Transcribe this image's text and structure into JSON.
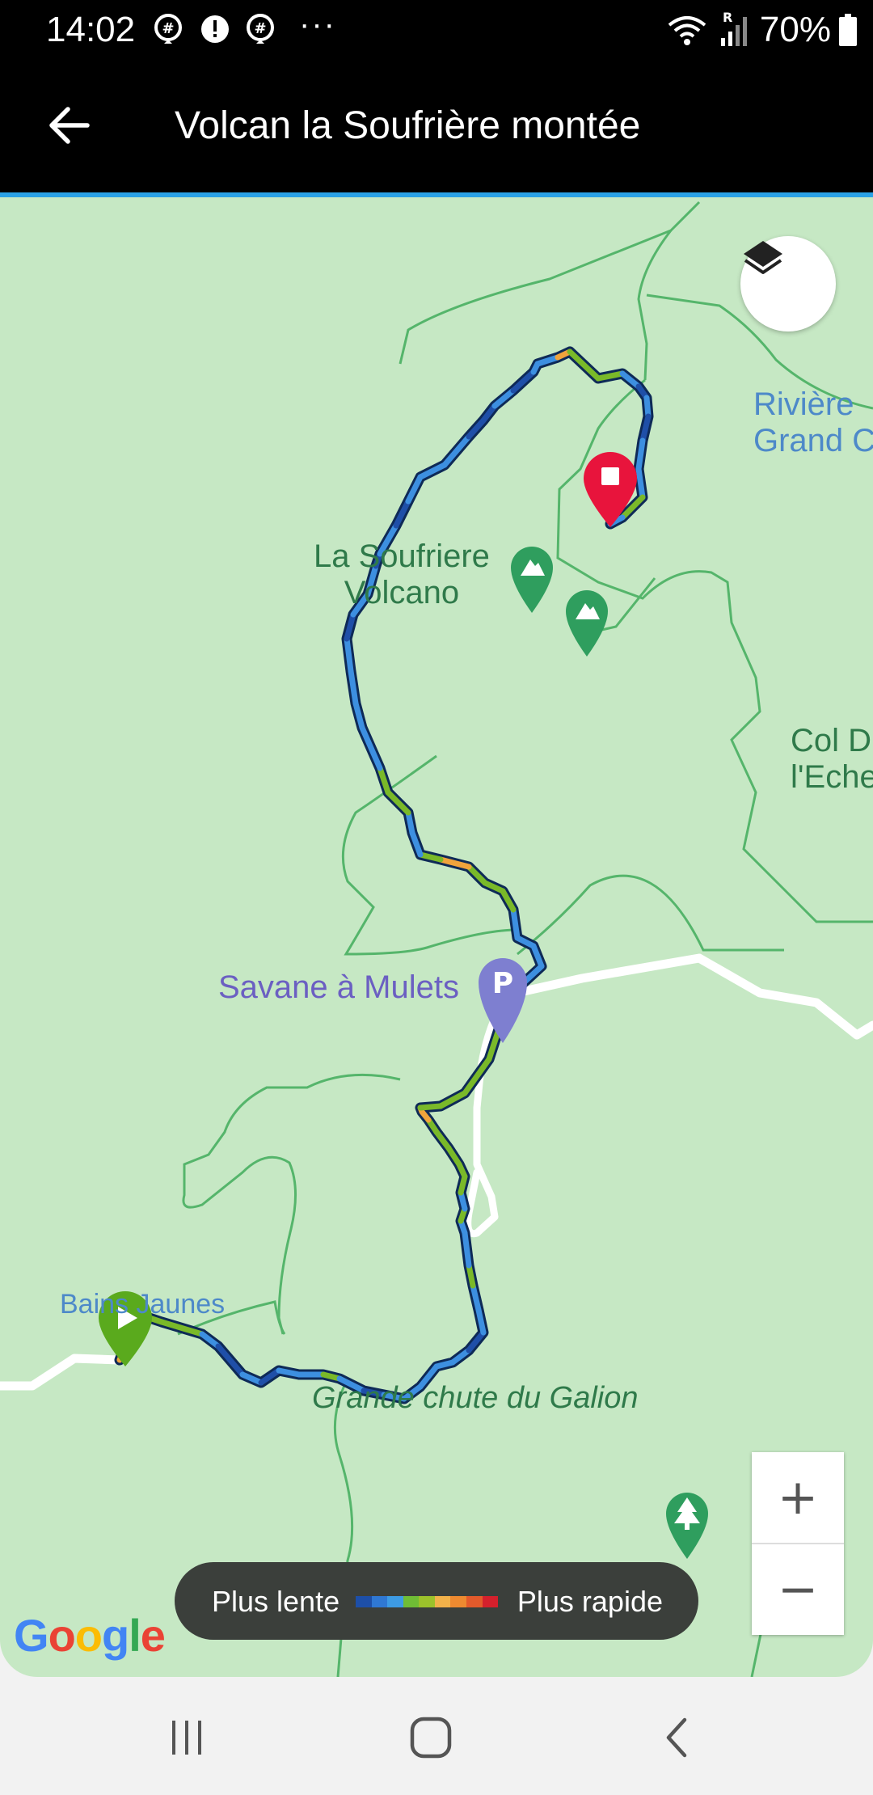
{
  "status_bar": {
    "time": "14:02",
    "dots": "···",
    "battery": "70%",
    "icons": [
      "hashtag-notification-icon",
      "alert-notification-icon",
      "hashtag-notification-icon",
      "wifi-icon",
      "roaming-signal-icon",
      "battery-icon"
    ]
  },
  "app_bar": {
    "title": "Volcan la Soufrière montée",
    "back_icon": "arrow-left-icon"
  },
  "map": {
    "labels": {
      "riviere": "Rivière\nGrand C",
      "soufriere": "La Soufriere\nVolcano",
      "col": "Col D\nl'Eche",
      "savane": "Savane à Mulets",
      "bains": "Bains Jaunes",
      "chute": "Grande chute du Galion"
    },
    "colors": {
      "land": "#c6e8c4",
      "contour": "#55b56b",
      "road": "#ffffff",
      "track_dark": "#1f4fa8",
      "track_mid": "#3d8fe0",
      "track_green": "#7ab929",
      "track_orange": "#f0a33c",
      "start_pin": "#5aaa1d",
      "end_pin": "#e8143c",
      "parking_pin": "#7e7fd0",
      "poi_green": "#2f9e5e"
    }
  },
  "legend": {
    "slow": "Plus lente",
    "fast": "Plus rapide",
    "gradient": [
      "#1d4fa8",
      "#2f78d3",
      "#3d9be4",
      "#6fbd35",
      "#9cc22b",
      "#f2b24a",
      "#ee8a30",
      "#e35a2b",
      "#d4202c"
    ]
  },
  "controls": {
    "zoom_in": "+",
    "zoom_out": "−",
    "layers_icon": "layers-icon"
  },
  "attribution": {
    "google": [
      "G",
      "o",
      "o",
      "g",
      "l",
      "e"
    ],
    "google_colors": [
      "#4285f4",
      "#ea4335",
      "#fbbc05",
      "#4285f4",
      "#34a853",
      "#ea4335"
    ]
  },
  "nav_bar": {
    "icons": [
      "recents-icon",
      "home-icon",
      "back-icon"
    ]
  }
}
